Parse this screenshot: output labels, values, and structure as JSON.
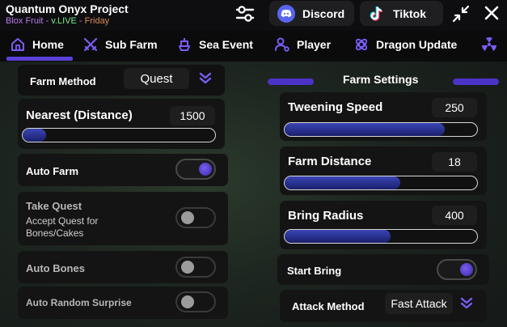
{
  "app": {
    "title": "Quantum Onyx Project",
    "subtitle_game": "Blox Fruit",
    "subtitle_sep1": " - ",
    "subtitle_version": "v.LIVE",
    "subtitle_sep2": " - ",
    "subtitle_day": "Friday"
  },
  "header": {
    "discord_label": "Discord",
    "tiktok_label": "Tiktok"
  },
  "tabs": [
    {
      "label": "Home",
      "icon": "home-icon",
      "active": true
    },
    {
      "label": "Sub Farm",
      "icon": "crossed-swords-icon"
    },
    {
      "label": "Sea Event",
      "icon": "ship-icon"
    },
    {
      "label": "Player",
      "icon": "player-icon"
    },
    {
      "label": "Dragon Update",
      "icon": "dragon-icon"
    }
  ],
  "left": {
    "farm_method": {
      "label": "Farm Method",
      "value": "Quest"
    },
    "nearest": {
      "label": "Nearest (Distance)",
      "value": "1500",
      "fill": 0.12
    },
    "auto_farm": {
      "label": "Auto Farm",
      "on": true
    },
    "take_quest": {
      "label": "Take Quest",
      "hint_line1": "Accept Quest for",
      "hint_line2": "Bones/Cakes",
      "on": false
    },
    "auto_bones": {
      "label": "Auto Bones",
      "on": false
    },
    "auto_random_surprise": {
      "label": "Auto Random Surprise",
      "on": false
    }
  },
  "right": {
    "section_title": "Farm Settings",
    "tweening_speed": {
      "label": "Tweening Speed",
      "value": "250",
      "fill": 0.83
    },
    "farm_distance": {
      "label": "Farm Distance",
      "value": "18",
      "fill": 0.6
    },
    "bring_radius": {
      "label": "Bring Radius",
      "value": "400",
      "fill": 0.55
    },
    "start_bring": {
      "label": "Start Bring",
      "on": true
    },
    "attack_method": {
      "label": "Attack Method",
      "value": "Fast Attack"
    }
  },
  "colors": {
    "accent": "#5b41d8",
    "slider_fill": "#2c3499",
    "panel": "#141414",
    "topbar": "#0e0e10"
  }
}
